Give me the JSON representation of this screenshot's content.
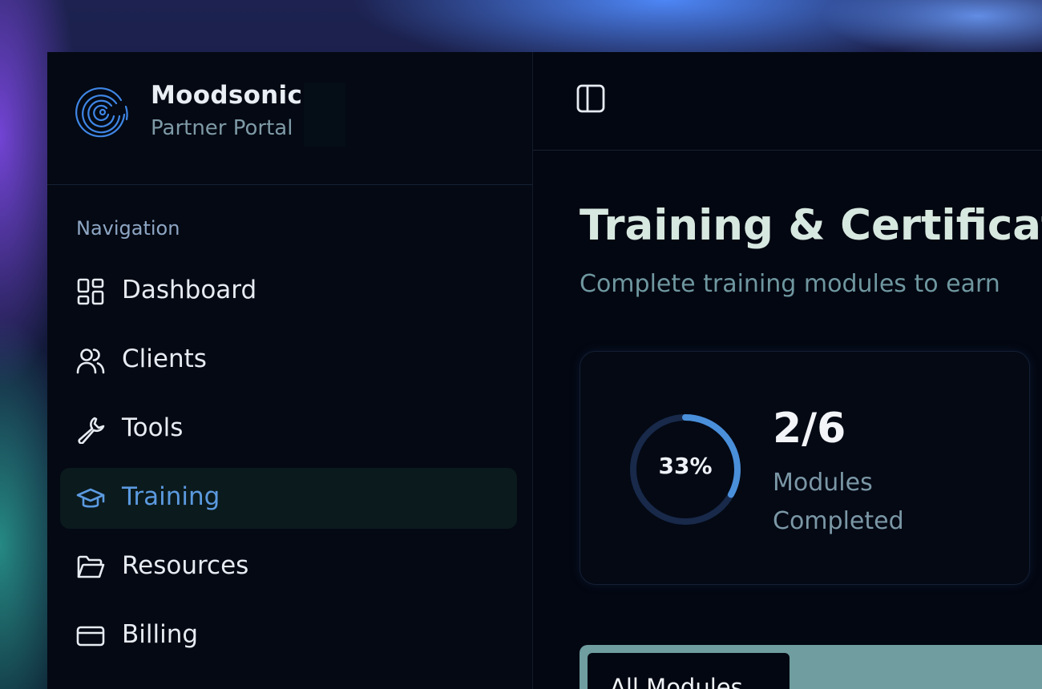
{
  "brand": {
    "name": "Moodsonic",
    "subtitle": "Partner Portal",
    "logo_icon": "concentric-rings-logo"
  },
  "sidebar": {
    "heading": "Navigation",
    "items": [
      {
        "label": "Dashboard",
        "icon": "grid-icon",
        "active": false
      },
      {
        "label": "Clients",
        "icon": "users-icon",
        "active": false
      },
      {
        "label": "Tools",
        "icon": "wrench-icon",
        "active": false
      },
      {
        "label": "Training",
        "icon": "graduation-cap-icon",
        "active": true
      },
      {
        "label": "Resources",
        "icon": "folder-icon",
        "active": false
      },
      {
        "label": "Billing",
        "icon": "credit-card-icon",
        "active": false
      }
    ]
  },
  "topbar": {
    "toggle_icon": "sidebar-toggle-icon"
  },
  "page": {
    "title": "Training & Certification",
    "subtitle": "Complete training modules to earn"
  },
  "progress_card": {
    "percent_label": "33%",
    "percent": 33,
    "count": "2/6",
    "label": "Modules Completed"
  },
  "tabs": {
    "active_label": "All Modules"
  },
  "colors": {
    "accent": "#4a8fda",
    "active_nav_bg": "#0b1a1d",
    "window_bg": "#030711",
    "ring_track": "#18294a"
  }
}
